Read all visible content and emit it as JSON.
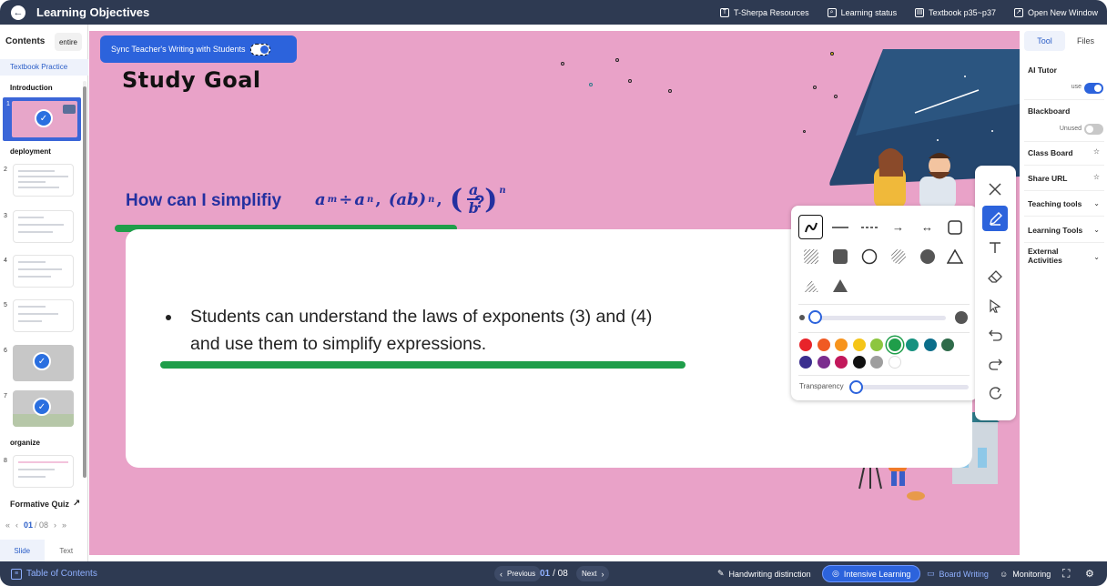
{
  "header": {
    "title": "Learning Objectives",
    "links": [
      "T-Sherpa Resources",
      "Learning status",
      "Textbook p35~p37",
      "Open New Window"
    ]
  },
  "sidebar": {
    "contents_label": "Contents",
    "entire_label": "entire",
    "practice_label": "Textbook Practice",
    "sections": [
      "Introduction",
      "deployment",
      "organize"
    ],
    "slide_numbers": [
      "1",
      "2",
      "3",
      "4",
      "5",
      "6",
      "7",
      "8"
    ],
    "formative_label": "Formative Quiz",
    "pager": {
      "current": "01",
      "total": "/ 08"
    },
    "view_tabs": [
      "Slide",
      "Text"
    ]
  },
  "stage": {
    "sync_label": "Sync Teacher's Writing with Students",
    "title": "Study Goal",
    "question": "How can I simplifiy",
    "formula": {
      "a": "a",
      "m": "m",
      "div": "÷",
      "n": "n",
      "ab": "(ab)",
      "b": "b",
      "q": "?"
    },
    "objective_line1": "Students can understand the laws of exponents (3) and (4)",
    "objective_line2": "and use them to simplify expressions."
  },
  "palette": {
    "transparency_label": "Transparency",
    "colors": [
      "#e8232a",
      "#f05a23",
      "#f7941d",
      "#f5c518",
      "#8dc63f",
      "#1f9e4a",
      "#16917f",
      "#0b6e8a",
      "#2f6b4a",
      "#3b2f8f",
      "#7b2d8e",
      "#c2185b",
      "#111111",
      "#9e9e9e",
      "#ffffff"
    ]
  },
  "right_panel": {
    "tabs": [
      "Tool",
      "Files"
    ],
    "ai_tutor": {
      "label": "AI Tutor",
      "state": "use"
    },
    "blackboard": {
      "label": "Blackboard",
      "state": "Unused"
    },
    "class_board": "Class Board",
    "share_url": "Share URL",
    "teaching_tools": "Teaching tools",
    "learning_tools": "Learning Tools",
    "external_activities": "External Activities"
  },
  "footer": {
    "toc": "Table of Contents",
    "previous": "Previous",
    "page_current": "01",
    "page_total": "/ 08",
    "next": "Next",
    "handwriting": "Handwriting distinction",
    "intensive": "Intensive Learning",
    "board_writing": "Board Writing",
    "monitoring": "Monitoring"
  }
}
